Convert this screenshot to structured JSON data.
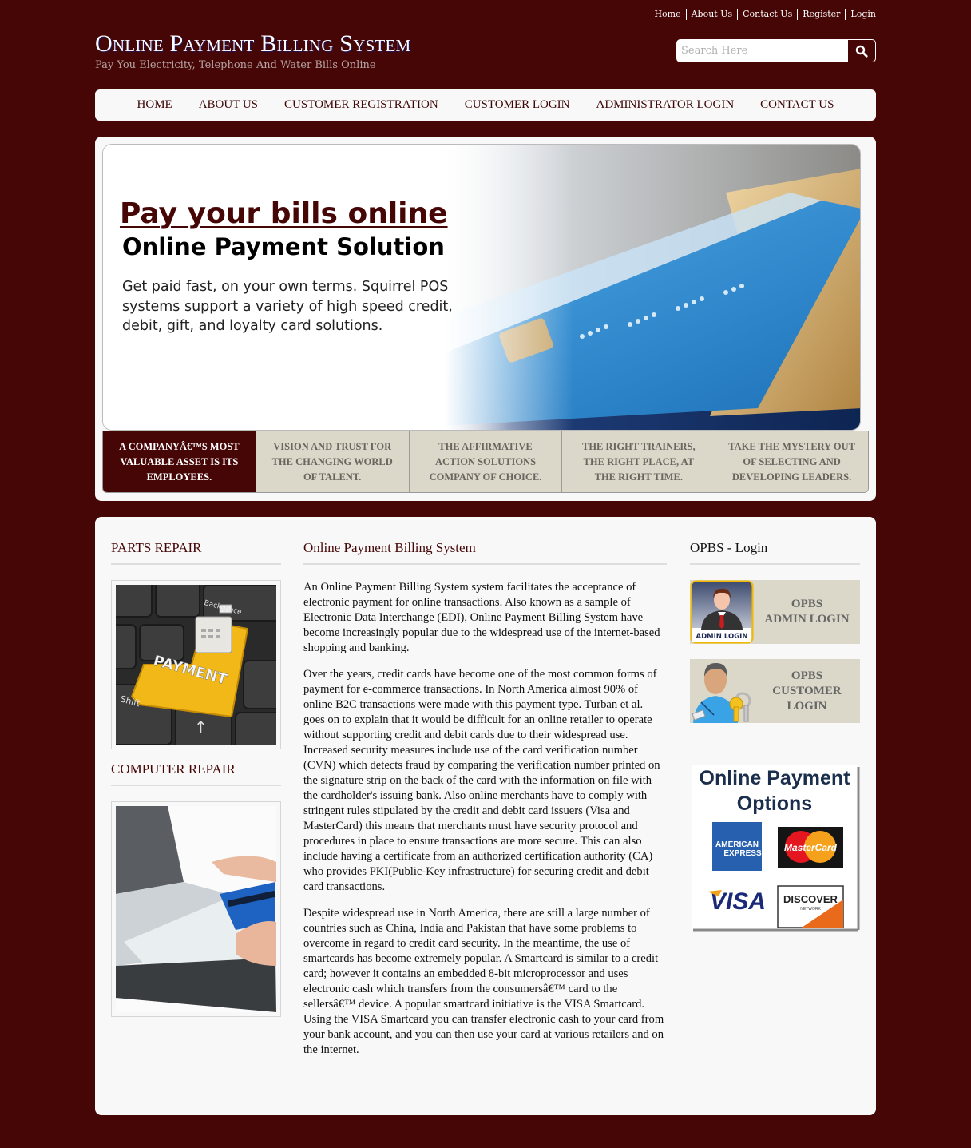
{
  "top_links": [
    "Home",
    "About Us",
    "Contact Us",
    "Register",
    "Login"
  ],
  "site": {
    "title": "Online Payment Billing System",
    "tagline": "Pay You Electricity, Telephone And Water Bills Online"
  },
  "search": {
    "placeholder": "Search Here",
    "value": "",
    "icon": "search-icon"
  },
  "nav": [
    "HOME",
    "ABOUT US",
    "CUSTOMER REGISTRATION",
    "CUSTOMER LOGIN",
    "ADMINISTRATOR LOGIN",
    "CONTACT US"
  ],
  "banner": {
    "title": "Pay your bills online",
    "subtitle": "Online Payment Solution",
    "description": "Get paid fast, on your own terms. Squirrel POS systems support a variety of high speed credit, debit, gift, and loyalty card solutions.",
    "image": "credit-cards-photo"
  },
  "slider_tabs": [
    {
      "label": "A COMPANYÂ€™S MOST VALUABLE ASSET IS ITS EMPLOYEES.",
      "active": true
    },
    {
      "label": "VISION AND TRUST FOR THE CHANGING WORLD OF TALENT.",
      "active": false
    },
    {
      "label": "THE AFFIRMATIVE ACTION SOLUTIONS COMPANY OF CHOICE.",
      "active": false
    },
    {
      "label": "THE RIGHT TRAINERS, THE RIGHT PLACE, AT THE RIGHT TIME.",
      "active": false
    },
    {
      "label": "TAKE THE MYSTERY OUT OF SELECTING AND DEVELOPING LEADERS.",
      "active": false
    }
  ],
  "left_column": {
    "sections": [
      {
        "title": "PARTS REPAIR",
        "image": "payment-keyboard-key",
        "image_text": "PAYMENT"
      },
      {
        "title": "COMPUTER REPAIR",
        "image": "laptop-credit-card-photo"
      }
    ]
  },
  "main": {
    "title": "Online Payment Billing System",
    "paragraphs": [
      "An Online Payment Billing System system facilitates the acceptance of electronic payment for online transactions. Also known as a sample of Electronic Data Interchange (EDI), Online Payment Billing System have become increasingly popular due to the widespread use of the internet-based shopping and banking.",
      "Over the years, credit cards have become one of the most common forms of payment for e-commerce transactions. In North America almost 90% of online B2C transactions were made with this payment type. Turban et al. goes on to explain that it would be difficult for an online retailer to operate without supporting credit and debit cards due to their widespread use. Increased security measures include use of the card verification number (CVN) which detects fraud by comparing the verification number printed on the signature strip on the back of the card with the information on file with the cardholder's issuing bank. Also online merchants have to comply with stringent rules stipulated by the credit and debit card issuers (Visa and MasterCard) this means that merchants must have security protocol and procedures in place to ensure transactions are more secure. This can also include having a certificate from an authorized certification authority (CA) who provides PKI(Public-Key infrastructure) for securing credit and debit card transactions.",
      "Despite widespread use in North America, there are still a large number of countries such as China, India and Pakistan that have some problems to overcome in regard to credit card security. In the meantime, the use of smartcards has become extremely popular. A Smartcard is similar to a credit card; however it contains an embedded 8-bit microprocessor and uses electronic cash which transfers from the consumersâ€™ card to the sellersâ€™ device. A popular smartcard initiative is the VISA Smartcard. Using the VISA Smartcard you can transfer electronic cash to your card from your bank account, and you can then use your card at various retailers and on the internet."
    ]
  },
  "right_column": {
    "title": "OPBS - Login",
    "admin_login": {
      "line1": "OPBS",
      "line2": "ADMIN LOGIN",
      "icon_caption": "ADMIN LOGIN",
      "icon": "admin-user-icon"
    },
    "customer_login": {
      "line1": "OPBS",
      "line2": "CUSTOMER",
      "line3": "LOGIN",
      "icon": "customer-key-icon"
    },
    "payment_options": {
      "title_line1": "Online Payment",
      "title_line2": "Options",
      "cards": [
        "AMERICAN",
        "EXPRESS",
        "MasterCard",
        "VISA",
        "DISCOVER",
        "NETWORK"
      ]
    }
  },
  "colors": {
    "background": "#460606",
    "panel": "#f8f8f8",
    "tab_inactive": "#dcd8c9",
    "accent": "#460606"
  }
}
